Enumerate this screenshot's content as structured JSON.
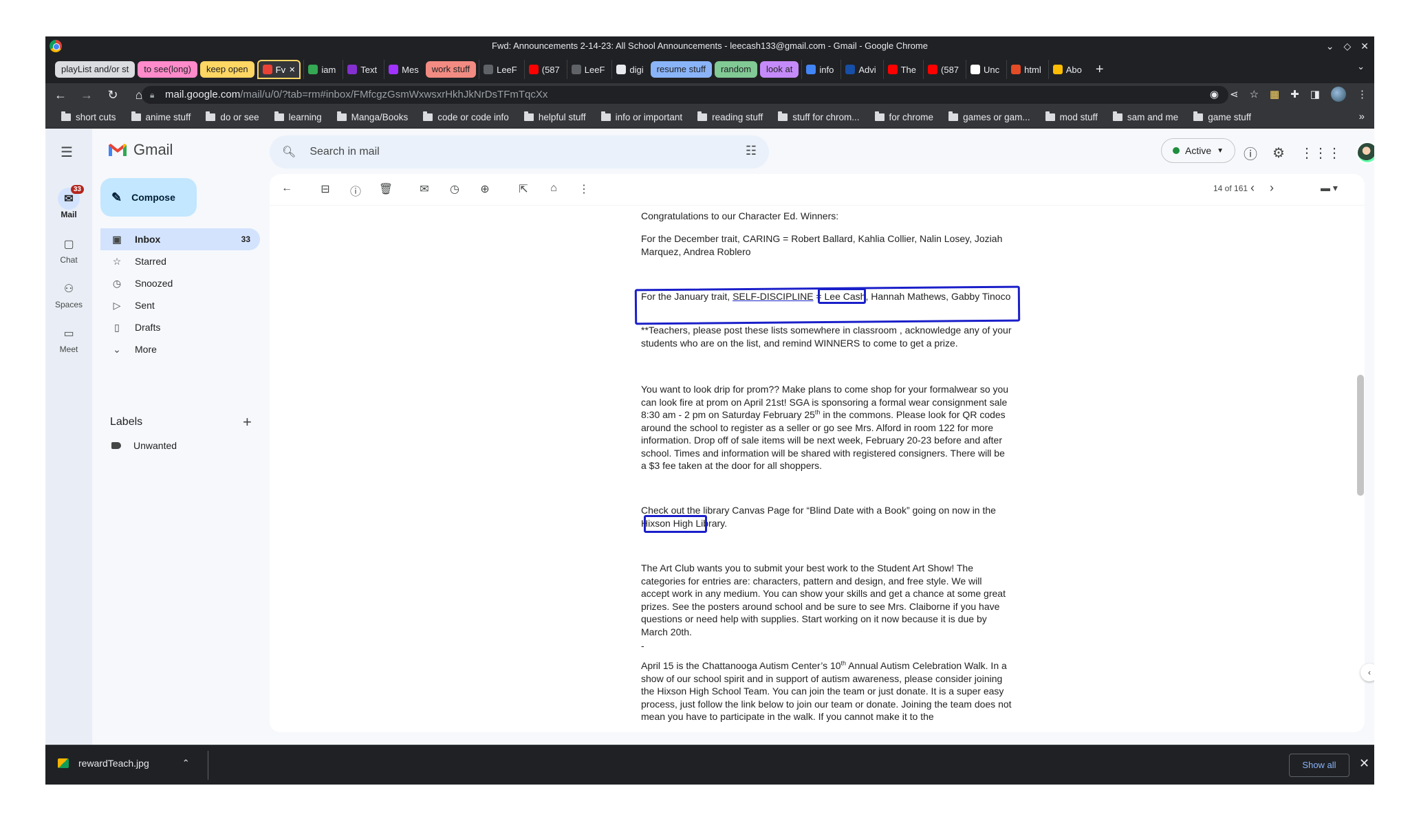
{
  "window": {
    "title": "Fwd: Announcements 2-14-23: All School Announcements - leecash133@gmail.com - Gmail - Google Chrome"
  },
  "tabs": [
    {
      "kind": "group",
      "label": "playList and/or st",
      "color": "#dadce0"
    },
    {
      "kind": "group",
      "label": "to see(long)",
      "color": "#ff8bcb"
    },
    {
      "kind": "group",
      "label": "keep open",
      "color": "#fdd663"
    },
    {
      "kind": "tab",
      "label": "Fv",
      "active": true,
      "icon": "gmail-icon"
    },
    {
      "kind": "tab",
      "label": "iam",
      "icon": "chat-icon"
    },
    {
      "kind": "tab",
      "label": "Text",
      "icon": "text-icon"
    },
    {
      "kind": "tab",
      "label": "Mes",
      "icon": "messenger-icon"
    },
    {
      "kind": "group",
      "label": "work stuff",
      "color": "#f28b82"
    },
    {
      "kind": "tab",
      "label": "LeeF",
      "icon": "github-icon"
    },
    {
      "kind": "tab",
      "label": "(587",
      "icon": "youtube-icon"
    },
    {
      "kind": "tab",
      "label": "LeeF",
      "icon": "github-icon"
    },
    {
      "kind": "tab",
      "label": "digi",
      "icon": "globe-icon"
    },
    {
      "kind": "group",
      "label": "resume stuff",
      "color": "#8ab4f8"
    },
    {
      "kind": "group",
      "label": "random",
      "color": "#81c995"
    },
    {
      "kind": "group",
      "label": "look at",
      "color": "#c58af9"
    },
    {
      "kind": "tab",
      "label": "info",
      "icon": "docs-icon"
    },
    {
      "kind": "tab",
      "label": "Advi",
      "icon": "crest-icon"
    },
    {
      "kind": "tab",
      "label": "The",
      "icon": "youtube-icon"
    },
    {
      "kind": "tab",
      "label": "(587",
      "icon": "youtube-icon"
    },
    {
      "kind": "tab",
      "label": "Unc",
      "icon": "google-icon"
    },
    {
      "kind": "tab",
      "label": "html",
      "icon": "html-icon"
    },
    {
      "kind": "tab",
      "label": "Abo",
      "icon": "drive-icon"
    }
  ],
  "address": {
    "host": "mail.google.com",
    "path": "/mail/u/0/?tab=rm#inbox/FMfcgzGsmWxwsxrHkhJkNrDsTFmTqcXx"
  },
  "bookmarks": [
    "short cuts",
    "anime stuff",
    "do or see",
    "learning",
    "Manga/Books",
    "code or code info",
    "helpful stuff",
    "info or important",
    "reading stuff",
    "stuff for chrom...",
    "for chrome",
    "games or gam...",
    "mod stuff",
    "sam and me",
    "game stuff"
  ],
  "gmail": {
    "app_name": "Gmail",
    "search_placeholder": "Search in mail",
    "status": "Active",
    "compose": "Compose",
    "rail": [
      {
        "label": "Mail",
        "badge": "33"
      },
      {
        "label": "Chat"
      },
      {
        "label": "Spaces"
      },
      {
        "label": "Meet"
      }
    ],
    "nav": [
      {
        "label": "Inbox",
        "count": "33"
      },
      {
        "label": "Starred"
      },
      {
        "label": "Snoozed"
      },
      {
        "label": "Sent"
      },
      {
        "label": "Drafts"
      },
      {
        "label": "More"
      }
    ],
    "labels_heading": "Labels",
    "labels": [
      "Unwanted"
    ],
    "counter": "14 of 161"
  },
  "message": {
    "p1": "Congratulations to our Character Ed. Winners:",
    "p2": "For the December trait, CARING = Robert Ballard, Kahlia Collier, Nalin Losey, Joziah Marquez, Andrea Roblero",
    "p3_a": "For the January trait, ",
    "p3_b": "SELF-DISCIPLINE",
    "p3_c": " = ",
    "p3_d": "Lee Cash",
    "p3_e": ", Hannah Mathews, Gabby Tinoco",
    "p4": "**Teachers, please post these lists somewhere in classroom , acknowledge any of your students who are on the list, and remind WINNERS to come to get a prize.",
    "p5_a": "You want to look drip for prom?? Make plans to come shop for your formalwear so you can look fire at prom on April 21st!  SGA is sponsoring a formal wear consignment sale 8:30 am - 2 pm on Saturday February 25",
    "p5_sup": "th",
    "p5_b": " in the commons. Please look for QR codes around the school to register as a seller or go see Mrs. Alford in room 122 for more information. Drop off of sale items will be next week, February 20-23 before and after school. Times and information will be shared with registered consigners. There will be a $3 fee taken at the door for all shoppers.",
    "p6": "Check out the library Canvas Page for “Blind Date with a Book” going on now in the Hixson High Library.",
    "p7": "The Art Club wants you to submit your best work to the Student Art Show! The categories for entries are: characters, pattern and design, and free style. We will accept work in any medium. You can show your skills and get a chance at some great prizes. See the posters around school and be sure to see Mrs. Claiborne if you have questions or need help with supplies. Start working on it now because it is due by March 20th.",
    "p8": "-",
    "p9_a": "April 15 is the Chattanooga Autism Center’s 10",
    "p9_sup": "th",
    "p9_b": " Annual Autism Celebration Walk.  In a show of our school spirit and in support of autism awareness, please consider joining the Hixson High School Team.  You can join the team or just donate. It is a super easy process, just follow the link below to join our team or donate. Joining the team does not mean you have to participate in the walk.  If you cannot make it to the"
  },
  "download": {
    "filename": "rewardTeach.jpg",
    "show_all": "Show all"
  }
}
